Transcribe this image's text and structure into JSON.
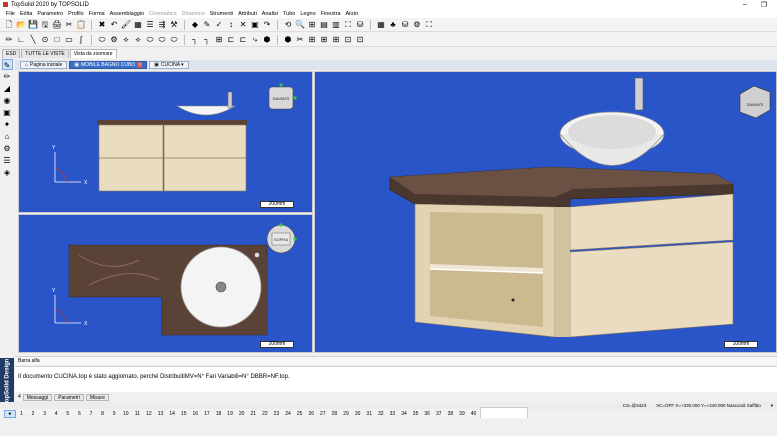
{
  "window": {
    "title": "TopSolid 2020 by TOPSOLID",
    "minimize": "–",
    "restore": "❐"
  },
  "menu": [
    "File",
    "Edita",
    "Parametro",
    "Profilo",
    "Forma",
    "Assemblaggio",
    "Cinematica",
    "Dinamico",
    "Strumenti",
    "Attributi",
    "Analisi",
    "Tubo",
    "Legno",
    "Finestra",
    "Aiuto"
  ],
  "menu_dim": [
    6,
    7
  ],
  "toolbar1": [
    "🗋",
    "📂",
    "💾",
    "🖫",
    "🖨",
    "✂",
    "📋",
    "✖",
    "↶",
    "🖌",
    "▦",
    "☰",
    "⇶",
    "⚒",
    "◆",
    "✎",
    "✓",
    "↕",
    "✕",
    "▣",
    "↷",
    "⟲",
    "🔍",
    "⊞",
    "▤",
    "▥",
    "⛶",
    "⛁",
    "▦",
    "♣",
    "⛁",
    "⚙",
    "⛶"
  ],
  "toolbar2": [
    "✏",
    "∟",
    "╲",
    "⊙",
    "□",
    "▭",
    "∫",
    "⬭",
    "⚙",
    "⟡",
    "⟡",
    "⬭",
    "⬭",
    "⬭",
    "┐",
    "┐",
    "⊞",
    "⊏",
    "⊏",
    "⤷",
    "⬢",
    "⬢",
    "✂",
    "⊞",
    "⊞",
    "⊞",
    "⊡",
    "⊡"
  ],
  "tabs": [
    {
      "label": "ESD",
      "active": false
    },
    {
      "label": "TUTTE LE VISTE",
      "active": false
    },
    {
      "label": "Vista da zoomare",
      "active": true
    }
  ],
  "doc_tabs": [
    {
      "label": "Pagina iniziale"
    },
    {
      "label": "MOBILE BAGNO CUBO",
      "close": "×"
    },
    {
      "label": "CUCINA ▾"
    }
  ],
  "left_tools": [
    "✎",
    "✏",
    "◢",
    "◉",
    "▣",
    "✦",
    "⌂",
    "⚙",
    "☰",
    "◈"
  ],
  "views": {
    "top_left": {
      "scale": "200mm",
      "cube_label": "DAVANTI"
    },
    "bottom_left": {
      "scale": "200mm",
      "cube_label": "SOPRA"
    },
    "main": {
      "scale": "100mm",
      "cube_label": "DAVANTI"
    }
  },
  "axis": {
    "x": "X",
    "y": "Y"
  },
  "status": {
    "hint": "Barra alfa"
  },
  "message": {
    "text": "Il documento CUCINA.top è stato aggiornato, perché DistribuitiMV=N° Fari Variabili=N° DBBR=NF.top."
  },
  "brand": "TopSolid  Design",
  "message_tabs": [
    "Messaggi",
    "Parametri",
    "Misure"
  ],
  "message_tab_index": "4",
  "coords": [
    "CS=@3423",
    "VC=OFF  X=+330.000  Y=+240.000  Nascondi  Saffitto",
    "▾"
  ],
  "layers": [
    "●",
    "1",
    "2",
    "3",
    "4",
    "5",
    "6",
    "7",
    "8",
    "9",
    "10",
    "11",
    "12",
    "13",
    "14",
    "15",
    "16",
    "17",
    "18",
    "19",
    "20",
    "21",
    "22",
    "23",
    "24",
    "25",
    "26",
    "27",
    "28",
    "29",
    "30",
    "31",
    "32",
    "33",
    "34",
    "35",
    "36",
    "37",
    "38",
    "39",
    "40"
  ],
  "colors": {
    "viewport_bg": "#2a55c8",
    "wood": "#e9dcc0",
    "marble": "#5a4236",
    "sink": "#f4f4f4"
  }
}
